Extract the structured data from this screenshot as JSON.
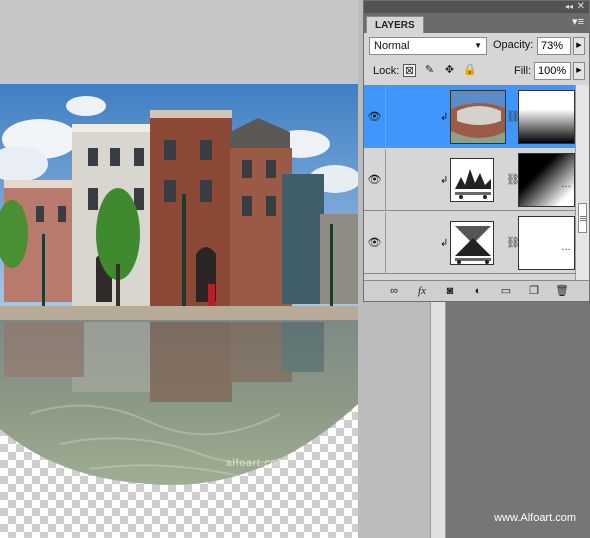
{
  "panel": {
    "tab_label": "LAYERS",
    "collapse_glyph": "◂◂",
    "close_glyph": "✕",
    "menu_glyph": "▾≡",
    "blend_mode": "Normal",
    "opacity_label": "Opacity:",
    "opacity_value": "73%",
    "lock_label": "Lock:",
    "fill_label": "Fill:",
    "fill_value": "100%"
  },
  "layers": [
    {
      "type": "image",
      "thumb_icon": "photo-thumbnail",
      "mask": "gradient-top-white-bottom-black",
      "selected": true
    },
    {
      "type": "curves-adjustment",
      "thumb_icon": "curves-histogram-icon",
      "mask": "gradient-diagonal-black-white",
      "selected": false
    },
    {
      "type": "levels-adjustment",
      "thumb_icon": "levels-icon",
      "mask": "white",
      "selected": false
    }
  ],
  "footer_icons": [
    "link-layers-icon",
    "fx-icon",
    "add-mask-icon",
    "adjustment-layer-icon",
    "group-folder-icon",
    "new-layer-icon",
    "trash-icon"
  ],
  "canvas": {
    "watermark": "alfoart.com"
  },
  "credit": "www.Alfoart.com",
  "colors": {
    "selected_layer": "#3f97fb",
    "panel_bg": "#d6d6d6",
    "desktop_dark": "#767676"
  }
}
